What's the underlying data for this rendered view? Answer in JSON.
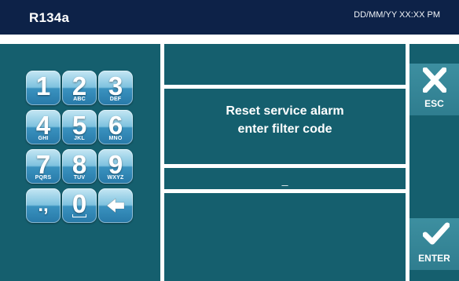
{
  "header": {
    "title": "R134a",
    "datetime": "DD/MM/YY XX:XX PM"
  },
  "message": {
    "line1": "Reset service alarm",
    "line2": "enter filter code"
  },
  "input": {
    "value": "_"
  },
  "keypad": [
    {
      "digit": "1",
      "letters": ""
    },
    {
      "digit": "2",
      "letters": "ABC"
    },
    {
      "digit": "3",
      "letters": "DEF"
    },
    {
      "digit": "4",
      "letters": "GHI"
    },
    {
      "digit": "5",
      "letters": "JKL"
    },
    {
      "digit": "6",
      "letters": "MNO"
    },
    {
      "digit": "7",
      "letters": "PQRS"
    },
    {
      "digit": "8",
      "letters": "TUV"
    },
    {
      "digit": "9",
      "letters": "WXYZ"
    },
    {
      "digit": ".,",
      "letters": ""
    },
    {
      "digit": "0",
      "letters": ""
    },
    {
      "digit": "",
      "letters": "",
      "icon": "backspace-arrow-icon"
    }
  ],
  "buttons": {
    "esc_label": "ESC",
    "enter_label": "ENTER"
  },
  "colors": {
    "header_bg": "#0d2248",
    "panel_bg": "#155f6e",
    "key_blue": "#3a92bf"
  }
}
